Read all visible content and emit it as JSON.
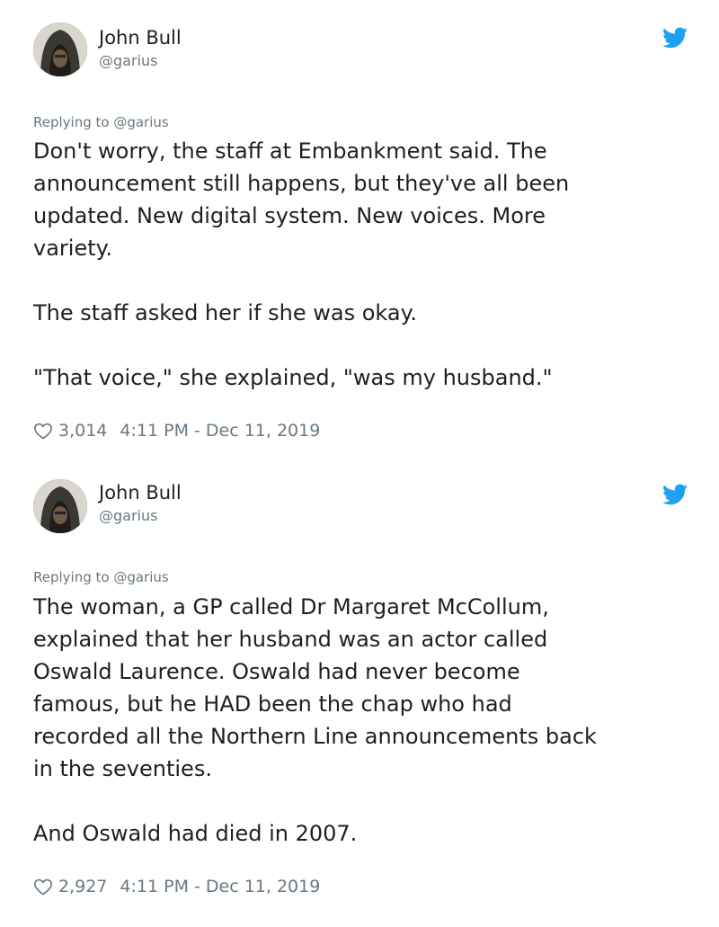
{
  "tweets": [
    {
      "author": {
        "name": "John Bull",
        "handle": "@garius"
      },
      "replying_to": "Replying to @garius",
      "paragraphs": [
        [
          "Don't worry, the staff at Embankment said. The",
          "announcement still happens, but they've all been",
          "updated. New digital system. New voices. More",
          "variety."
        ],
        [
          "The staff asked her if she was okay."
        ],
        [
          "\"That voice,\" she explained, \"was my husband.\""
        ]
      ],
      "likes": "3,014",
      "timestamp": "4:11 PM - Dec 11, 2019"
    },
    {
      "author": {
        "name": "John Bull",
        "handle": "@garius"
      },
      "replying_to": "Replying to @garius",
      "paragraphs": [
        [
          "The woman, a GP called Dr Margaret McCollum,",
          "explained that her husband was an actor called",
          "Oswald Laurence. Oswald had never become",
          "famous, but he HAD been the chap who had",
          "recorded all the Northern Line announcements back",
          "in the seventies."
        ],
        [
          "And Oswald had died in 2007."
        ]
      ],
      "likes": "2,927",
      "timestamp": "4:11 PM - Dec 11, 2019"
    }
  ],
  "icons": {
    "platform": "twitter-bird-icon",
    "like": "heart-outline-icon"
  },
  "colors": {
    "twitter_blue": "#1da1f2",
    "text": "#1c2022",
    "secondary_text": "#697882"
  }
}
